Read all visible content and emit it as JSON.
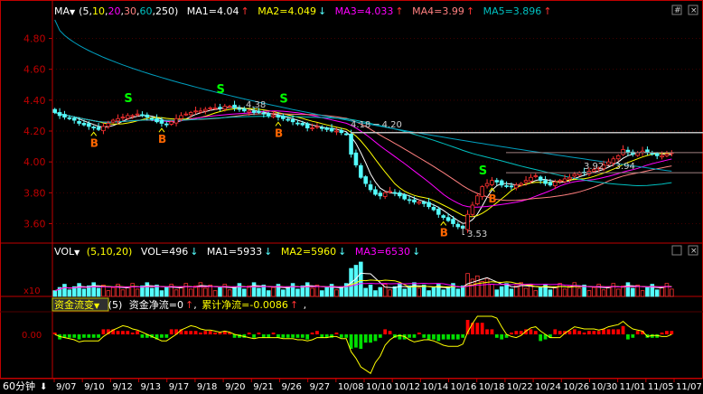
{
  "main_legend": {
    "indicator": "MA",
    "params_open": "(",
    "p1": "5",
    "p2": "10",
    "p3": "20",
    "p4": "30",
    "p5": "60",
    "p6": "250",
    "params_close": ")",
    "ma1": "MA1=4.04",
    "ma2": "MA2=4.049",
    "ma3": "MA3=4.033",
    "ma4": "MA4=3.99",
    "ma5": "MA5=3.896",
    "arrow_up": "↑",
    "arrow_down": "↓"
  },
  "vol_legend": {
    "indicator": "VOL",
    "params": "(5,10,20)",
    "vol": "VOL=496",
    "ma1": "MA1=5933",
    "ma2": "MA2=5960",
    "ma3": "MA3=6530",
    "multiplier": "x10"
  },
  "flow_legend": {
    "indicator": "资金流变",
    "params": "(5)",
    "net": "资金净流=0",
    "cum": "累计净流=-0.0086",
    "tail": ",",
    "zero_label": "0.00"
  },
  "bottom_bar": {
    "period_label": "60分钟",
    "dates": [
      "9/07",
      "9/10",
      "9/12",
      "9/13",
      "9/17",
      "9/18",
      "9/20",
      "9/21",
      "9/26",
      "9/27",
      "10/08",
      "10/10",
      "10/12",
      "10/14",
      "10/16",
      "10/18",
      "10/22",
      "10/24",
      "10/26",
      "10/30",
      "11/01",
      "11/05",
      "11/07"
    ]
  },
  "annotations": {
    "sell": "S",
    "buy": "B",
    "high_1": "4.38",
    "range_mid": "4.18 ─ 4.20",
    "low": "3.53",
    "range_right": "3.92 ─ 3.94"
  },
  "colors": {
    "up": "#ff3232",
    "down": "#54fcfc",
    "ma1": "#ffffff",
    "ma2": "#ffff00",
    "ma3": "#ff00ff",
    "ma4": "#ff8080",
    "ma5": "#00c0c0",
    "axis": "#c00000",
    "sell": "#00ff00",
    "buy": "#ff6600",
    "flow_pos": "#ff0000",
    "flow_neg": "#00e000",
    "flow_line": "#ffff00"
  },
  "chart_data": {
    "type": "candlestick",
    "interval": "60分钟",
    "y_axis": {
      "ticks": [
        "4.80",
        "4.60",
        "4.40",
        "4.20",
        "4.00",
        "3.80",
        "3.60"
      ],
      "range": [
        3.48,
        4.92
      ]
    },
    "close": [
      4.32,
      4.3,
      4.29,
      4.28,
      4.27,
      4.25,
      4.24,
      4.23,
      4.22,
      4.21,
      4.23,
      4.25,
      4.27,
      4.28,
      4.29,
      4.3,
      4.3,
      4.31,
      4.3,
      4.29,
      4.28,
      4.26,
      4.25,
      4.24,
      4.26,
      4.28,
      4.3,
      4.31,
      4.32,
      4.33,
      4.33,
      4.34,
      4.35,
      4.35,
      4.35,
      4.36,
      4.36,
      4.35,
      4.34,
      4.33,
      4.33,
      4.32,
      4.32,
      4.31,
      4.3,
      4.3,
      4.29,
      4.28,
      4.27,
      4.26,
      4.25,
      4.24,
      4.22,
      4.22,
      4.23,
      4.22,
      4.21,
      4.2,
      4.2,
      4.19,
      4.18,
      4.05,
      3.98,
      3.9,
      3.86,
      3.82,
      3.79,
      3.78,
      3.8,
      3.81,
      3.8,
      3.78,
      3.76,
      3.75,
      3.74,
      3.74,
      3.73,
      3.71,
      3.69,
      3.66,
      3.64,
      3.62,
      3.6,
      3.58,
      3.57,
      3.66,
      3.72,
      3.78,
      3.84,
      3.86,
      3.88,
      3.87,
      3.85,
      3.84,
      3.84,
      3.85,
      3.86,
      3.88,
      3.9,
      3.91,
      3.88,
      3.86,
      3.85,
      3.87,
      3.88,
      3.89,
      3.9,
      3.92,
      3.93,
      3.93,
      3.94,
      3.95,
      3.96,
      3.98,
      4.0,
      4.02,
      4.04,
      4.08,
      4.06,
      4.05,
      4.06,
      4.07,
      4.06,
      4.05,
      4.04,
      4.04,
      4.05,
      4.06
    ],
    "series": [
      {
        "name": "MA1",
        "param": 5,
        "last": 4.04
      },
      {
        "name": "MA2",
        "param": 10,
        "last": 4.049
      },
      {
        "name": "MA3",
        "param": 20,
        "last": 4.033
      },
      {
        "name": "MA4",
        "param": 30,
        "last": 3.99
      },
      {
        "name": "MA5",
        "param": 60,
        "last": 3.896
      }
    ],
    "signals": {
      "sell_at_bar": [
        15,
        34,
        47,
        88
      ],
      "buy_at_bar": [
        8,
        22,
        46,
        80,
        90
      ]
    },
    "volume": {
      "ma": [
        5933,
        5960,
        6530
      ],
      "last": 496
    },
    "money_flow": {
      "net": 0,
      "cumulative": -0.0086
    }
  }
}
